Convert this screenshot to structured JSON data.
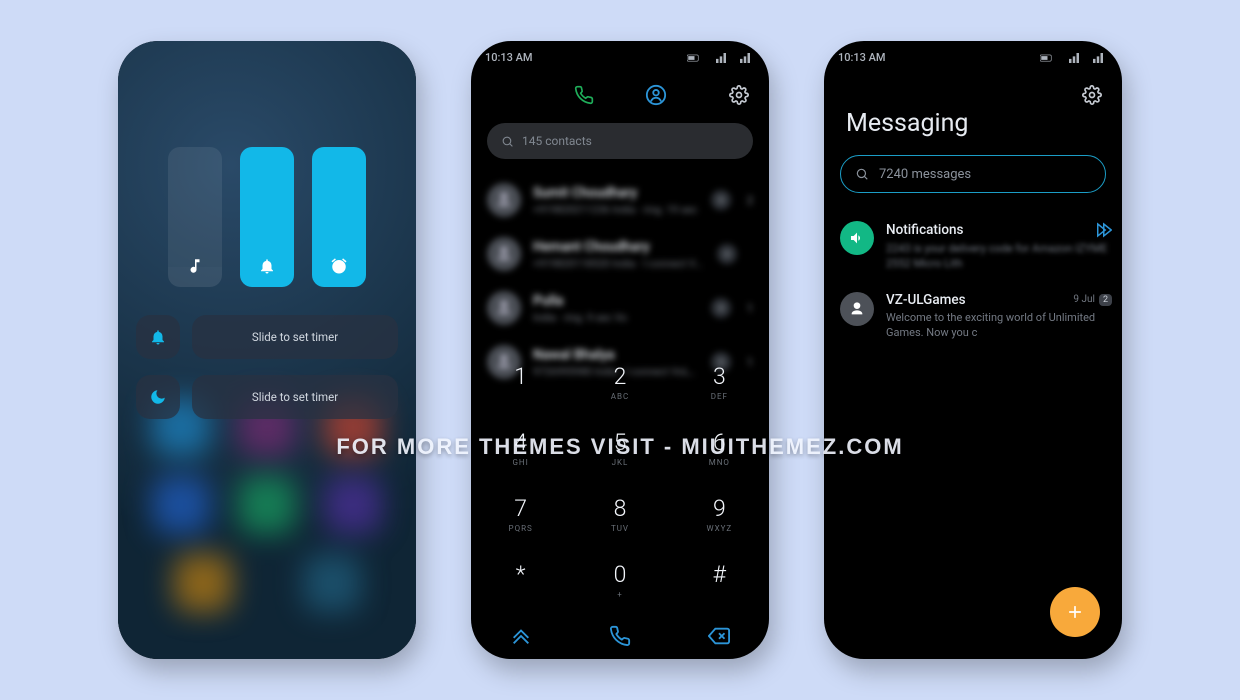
{
  "status": {
    "time": "10:13 AM"
  },
  "watermark": "FOR MORE THEMES VISIT - MIUITHEMEZ.COM",
  "phone1": {
    "row1_label": "Slide to set timer",
    "row2_label": "Slide to set timer"
  },
  "phone2": {
    "search_placeholder": "145 contacts",
    "contacts": [
      {
        "name": "Sumit Choudhary",
        "sub": "+919820211236 India · ring. 19 sec",
        "idx": "2"
      },
      {
        "name": "Hemant Choudhary",
        "sub": "+919820118520 India · I connect VoLT",
        "idx": ""
      },
      {
        "name": "Pulla",
        "sub": "India · ring. 9 sec Vo",
        "idx": "1"
      },
      {
        "name": "Nawal Bhalya",
        "sub": "9726995980 India · I connect VoLTE",
        "idx": "1"
      }
    ],
    "keys": [
      {
        "n": "1",
        "l": ""
      },
      {
        "n": "2",
        "l": "ABC"
      },
      {
        "n": "3",
        "l": "DEF"
      },
      {
        "n": "4",
        "l": "GHI"
      },
      {
        "n": "5",
        "l": "JKL"
      },
      {
        "n": "6",
        "l": "MNO"
      },
      {
        "n": "7",
        "l": "PQRS"
      },
      {
        "n": "8",
        "l": "TUV"
      },
      {
        "n": "9",
        "l": "WXYZ"
      },
      {
        "n": "*",
        "l": ""
      },
      {
        "n": "0",
        "l": "+"
      },
      {
        "n": "#",
        "l": ""
      }
    ]
  },
  "phone3": {
    "title": "Messaging",
    "search_placeholder": "7240 messages",
    "items": [
      {
        "title": "Notifications",
        "sub": "2243 is your delivery code for Amazon IZYME 2552 Micro Lith",
        "green": true,
        "blur_sub": true
      },
      {
        "title": "VZ-ULGames",
        "sub": "Welcome to the exciting world of Unlimited Games. Now you c",
        "date": "9 Jul",
        "badge": "2",
        "green": false,
        "blur_sub": false
      }
    ]
  }
}
